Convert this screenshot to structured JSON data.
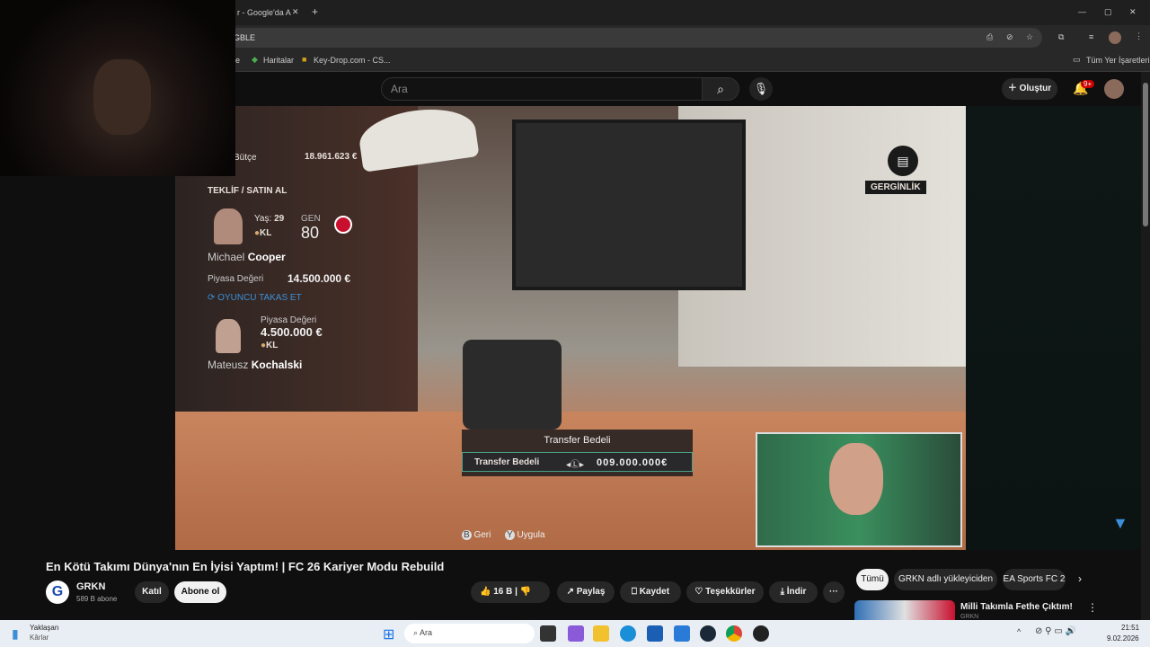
{
  "browser": {
    "tab_title": "r - Google'da A",
    "new_tab": "+",
    "address": "GBLE",
    "bookmarks": [
      "e",
      "Haritalar",
      "Key-Drop.com - CS..."
    ],
    "all_bookmarks": "Tüm Yer İşaretleri",
    "window": {
      "min": "—",
      "max": "▢",
      "close": "✕"
    }
  },
  "youtube": {
    "search_placeholder": "Ara",
    "create": "Oluştur",
    "notif_badge": "9+"
  },
  "game": {
    "budget_label": "Bütçe",
    "budget": "18.961.623 €",
    "offer_title": "TEKLİF / SATIN AL",
    "player1": {
      "age_label": "Yaş:",
      "age": "29",
      "position": "KL",
      "gen_label": "GEN",
      "gen": "80",
      "first": "Michael",
      "last": "Cooper",
      "value_label": "Piyasa Değeri",
      "value": "14.500.000 €"
    },
    "swap_label": "OYUNCU TAKAS ET",
    "player2": {
      "value_label": "Piyasa Değeri",
      "value": "4.500.000 €",
      "position": "KL",
      "first": "Mateusz",
      "last": "Kochalski"
    },
    "tension": "GERGİNLİK",
    "transfer_title": "Transfer Bedeli",
    "transfer_label": "Transfer Bedeli",
    "transfer_value": "009.000.000€",
    "btn_back_key": "B",
    "btn_back": "Geri",
    "btn_apply_key": "Y",
    "btn_apply": "Uygula"
  },
  "video": {
    "title": "En Kötü Takımı Dünya'nın En İyisi Yaptım! | FC 26 Kariyer Modu Rebuild",
    "channel": "GRKN",
    "subs": "589 B abone",
    "join": "Katıl",
    "subscribe": "Abone ol",
    "likes": "16 B",
    "share": "Paylaş",
    "save": "Kaydet",
    "thanks": "Teşekkürler",
    "download": "İndir",
    "more": "···"
  },
  "sidebar": {
    "chips": [
      "Tümü",
      "GRKN adlı yükleyiciden",
      "EA Sports FC 2"
    ],
    "rec_title": "Milli Takımla Fethe Çıktım!",
    "rec_channel": "GRKN"
  },
  "taskbar": {
    "weather_title": "Yaklaşan",
    "weather_sub": "Kârlar",
    "search": "Ara",
    "time": "21:51",
    "date": "9.02.2026"
  }
}
